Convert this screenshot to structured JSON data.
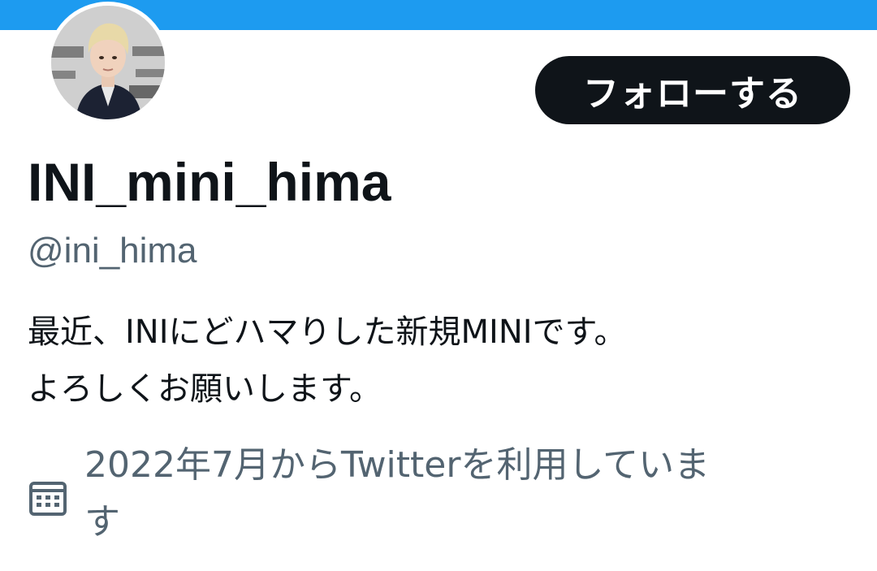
{
  "colors": {
    "banner": "#1d9bf0",
    "follow_button_bg": "#0f1419",
    "follow_button_text": "#ffffff",
    "primary_text": "#0f1419",
    "secondary_text": "#536471"
  },
  "profile": {
    "follow_label": "フォローする",
    "display_name": "INI_mini_hima",
    "handle": "@ini_hima",
    "bio_lines": [
      "最近、INIにどハマりした新規MINIです。",
      "よろしくお願いします。"
    ],
    "joined_lines": [
      "2022年7月からTwitterを利用していま",
      "す"
    ],
    "joined_icon": "calendar-icon",
    "avatar_icon": "avatar"
  }
}
